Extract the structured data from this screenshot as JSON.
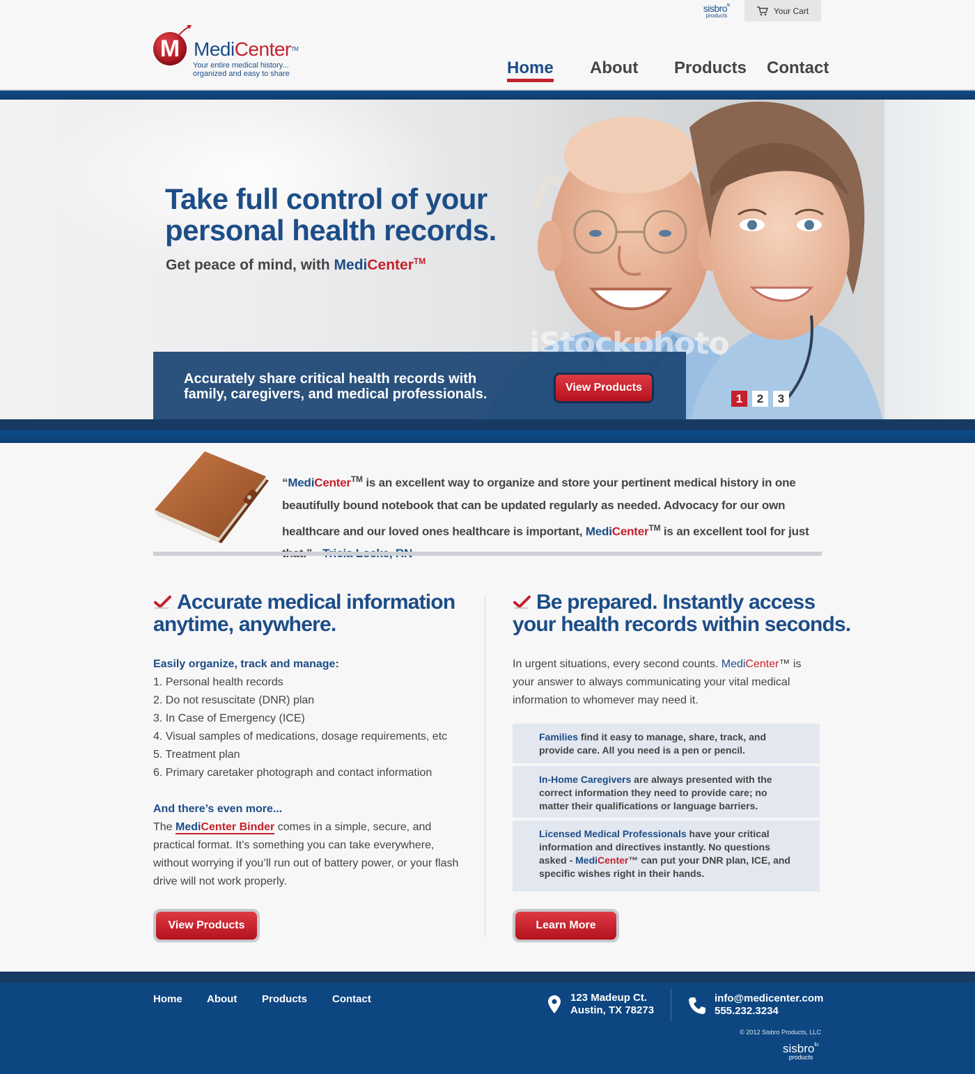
{
  "header": {
    "partner": {
      "name": "sisbro",
      "suffix": "llc",
      "sub": "products"
    },
    "cart_label": "Your Cart",
    "logo": {
      "name_part1": "Medi",
      "name_part2": "Center",
      "tm": "TM",
      "tagline_line1": "Your entire medical history...",
      "tagline_line2": "organized and easy to share"
    },
    "nav": [
      {
        "label": "Home",
        "active": true
      },
      {
        "label": "About",
        "active": false
      },
      {
        "label": "Products",
        "active": false
      },
      {
        "label": "Contact",
        "active": false
      }
    ]
  },
  "hero": {
    "title": "Take full control of your personal health records.",
    "subtitle_prefix": "Get peace of mind, with ",
    "brand_part1": "Medi",
    "brand_part2": "Center",
    "tm": "TM",
    "watermark": "iStockphoto",
    "bar_text": "Accurately share critical health records with family, caregivers, and medical professionals.",
    "button_label": "View Products",
    "slides": [
      "1",
      "2",
      "3"
    ],
    "active_slide": 1
  },
  "testimonial": {
    "open_quote": "“",
    "brand_part1": "Medi",
    "brand_part2": "Center",
    "tm": "TM",
    "text_a": " is an excellent way to organize and store your pertinent medical history in one beautifully bound notebook that can be updated regularly as needed.  Advocacy for our own healthcare and our loved ones healthcare is important, ",
    "text_b": " is an excellent tool for just that.”",
    "bullet": "•",
    "author": "Tricia Locke, RN"
  },
  "left_column": {
    "title_line1": "Accurate medical information",
    "title_line2": "anytime, anywhere.",
    "list_heading": "Easily organize, track and manage:",
    "items": [
      "1. Personal health records",
      "2. Do not resuscitate (DNR) plan",
      "3. In Case of Emergency (ICE)",
      "4. Visual samples of medications, dosage requirements, etc",
      "5. Treatment plan",
      "6. Primary caretaker photograph and contact information"
    ],
    "more_heading": "And there’s even more...",
    "more_prefix": "The ",
    "more_link_part1": "Medi",
    "more_link_part2": "Center Binder",
    "more_text": " comes in a simple, secure, and practical format. It’s something you can take everywhere, without worrying if you’ll run out of battery power, or your flash drive will not work properly.",
    "button_label": "View Products"
  },
  "right_column": {
    "title_line1": "Be prepared. Instantly access",
    "title_line2": "your health records within seconds.",
    "intro_prefix": "In urgent situations, every second counts. ",
    "brand_part1": "Medi",
    "brand_part2": "Center",
    "intro_suffix": "™ is your answer to always communicating your vital medical information to whomever may need it.",
    "boxes": [
      {
        "lead": "Families",
        "text": " find it easy to manage, share, track, and provide care. All you need is a pen or pencil."
      },
      {
        "lead": "In-Home Caregivers",
        "text": " are always presented with the correct information they need to provide care; no matter their qualifications or language barriers."
      },
      {
        "lead": "Licensed Medical Professionals",
        "text": " have your critical information and directives instantly. No questions asked - ",
        "brand_part1": "Medi",
        "brand_part2": "Center",
        "text_after": "™ can put your DNR plan, ICE, and specific wishes right in their hands."
      }
    ],
    "button_label": "Learn More"
  },
  "footer": {
    "nav": [
      "Home",
      "About",
      "Products",
      "Contact"
    ],
    "address_line1": "123 Madeup Ct.",
    "address_line2": "Austin, TX 78273",
    "email": "info@medicenter.com",
    "phone": "555.232.3234",
    "copyright": "© 2012 Sisbro Products, LLC",
    "partner": {
      "name": "sisbro",
      "suffix": "llc",
      "sub": "products"
    }
  },
  "colors": {
    "brand_blue": "#1c4d87",
    "brand_red": "#c4212c",
    "footer_blue": "#0d4681"
  }
}
